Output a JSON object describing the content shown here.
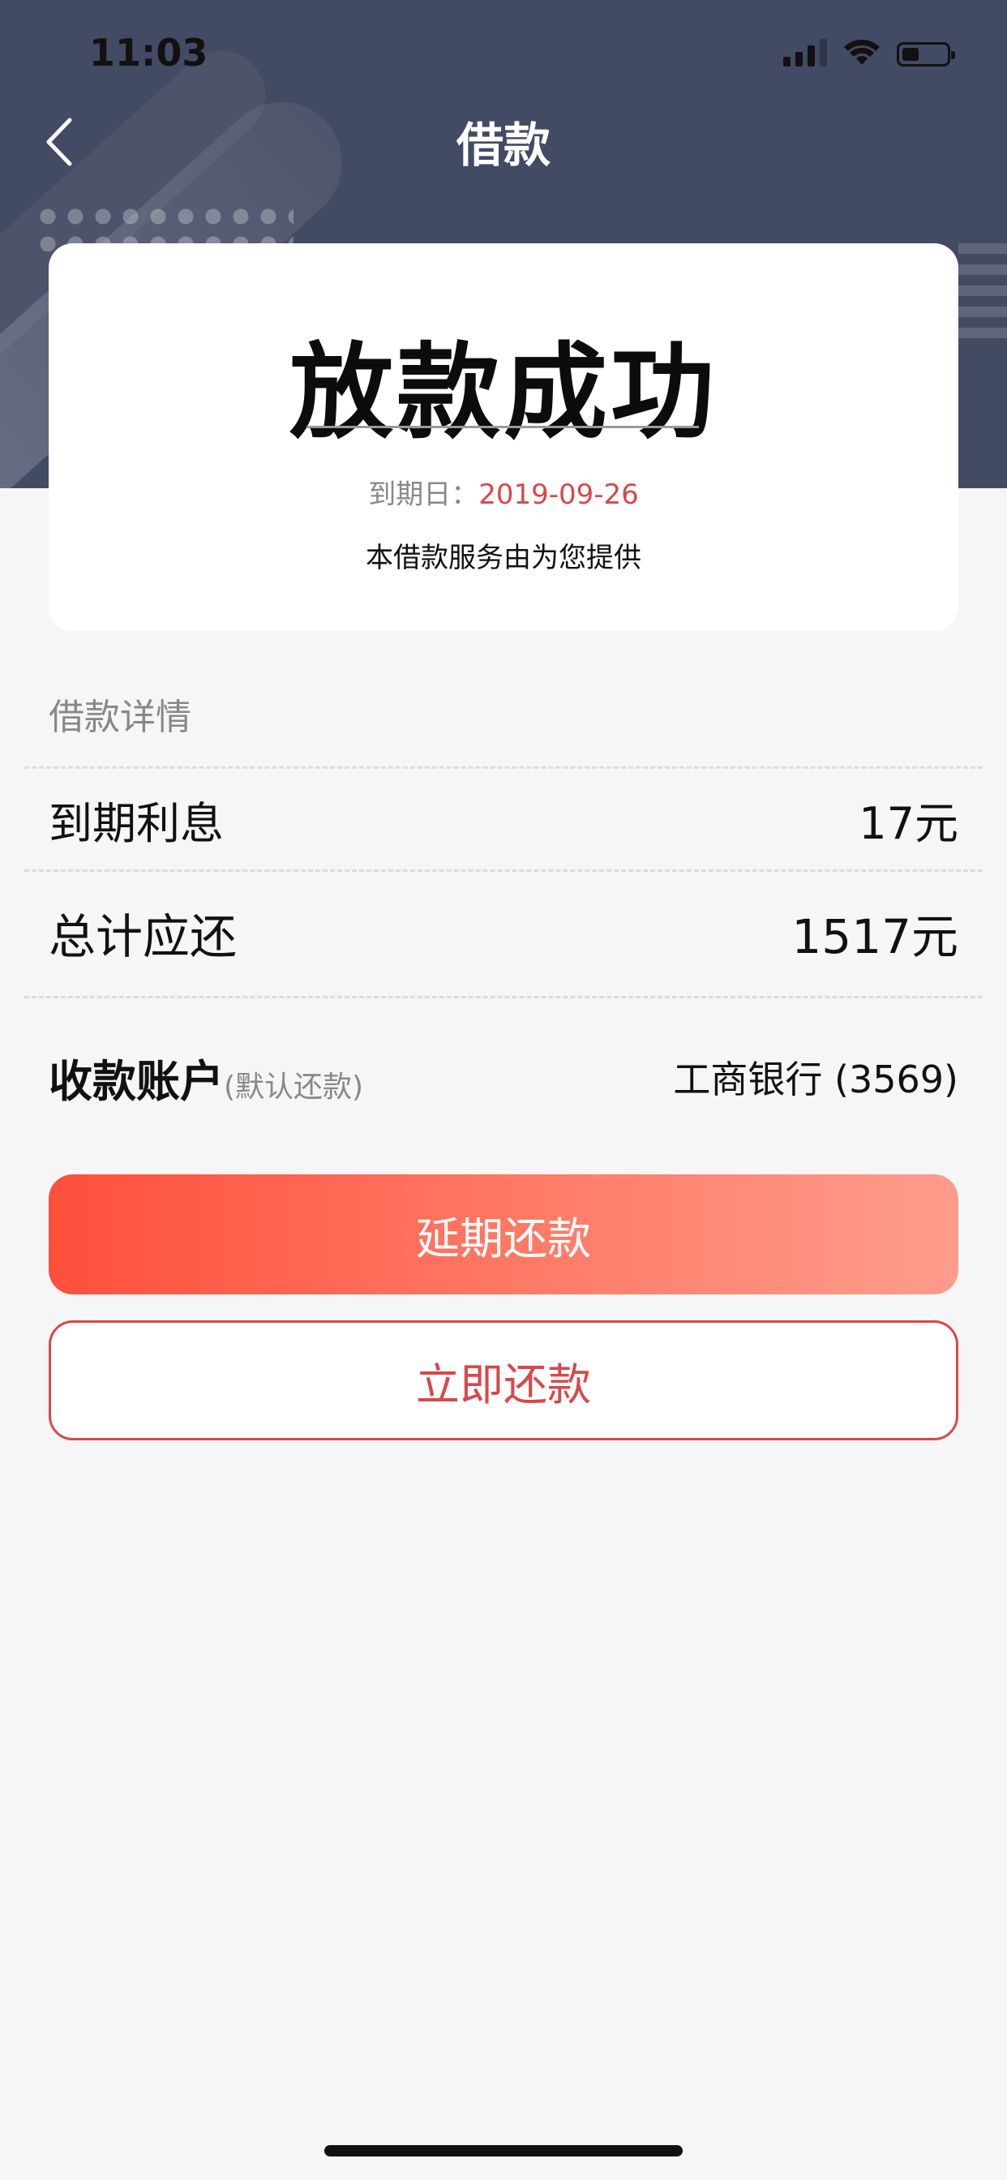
{
  "status": {
    "time": "11:03"
  },
  "header": {
    "title": "借款"
  },
  "card": {
    "title": "放款成功",
    "due_label": "到期日：",
    "due_date": "2019-09-26",
    "provider_text": "本借款服务由为您提供"
  },
  "details": {
    "section_title": "借款详情",
    "interest_label": "到期利息",
    "interest_value": "17元",
    "total_label": "总计应还",
    "total_value": "1517元",
    "account_label": "收款账户",
    "account_hint": "(默认还款)",
    "account_value": "工商银行 (3569)"
  },
  "actions": {
    "extend_label": "延期还款",
    "repay_label": "立即还款"
  },
  "colors": {
    "header_bg": "#434a64",
    "accent_red": "#d9474a",
    "button_gradient_start": "#ff4f3b",
    "button_gradient_end": "#ff9c8c"
  }
}
